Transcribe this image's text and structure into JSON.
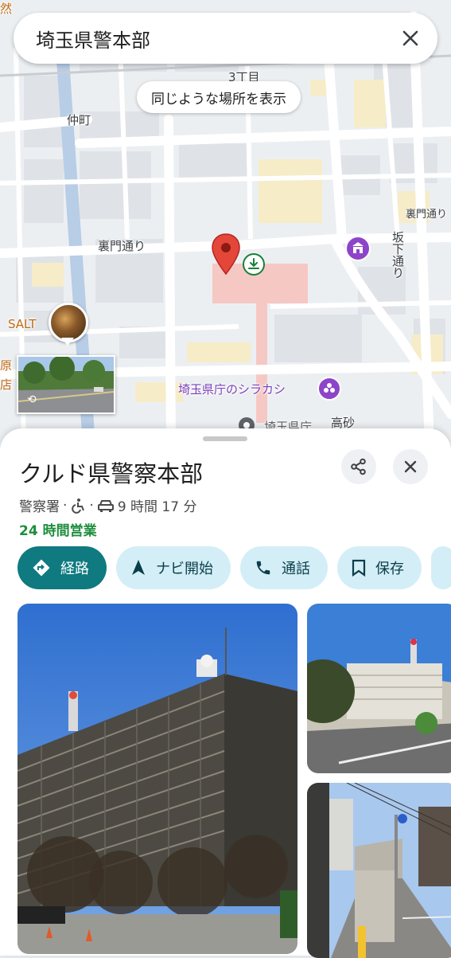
{
  "search": {
    "query": "埼玉県警本部"
  },
  "map": {
    "chip_label": "同じような場所を表示",
    "labels": {
      "nakacho": "仲町",
      "sanchome": "3丁目",
      "uramon_left": "裏門通り",
      "uramon_right": "裏門通り",
      "sakashita": "坂下通り",
      "salt": "SALT",
      "shirakashi": "埼玉県庁のシラカシ",
      "kencho": "埼玉県庁",
      "takasago": "高砂",
      "edge_left_top": "原",
      "edge_left_bottom": "店",
      "corner_top_left": "然"
    },
    "colors": {
      "pin_red": "#e5463a",
      "poi_purple": "#8e44c9",
      "download_green": "#188038"
    }
  },
  "place": {
    "title": "クルド県警察本部",
    "category": "警察署",
    "separator": "·",
    "drive_time": "9 時間 17 分",
    "hours": "24 時間営業"
  },
  "actions": {
    "directions": "経路",
    "navigate": "ナビ開始",
    "call": "通話",
    "save": "保存"
  },
  "icons": {
    "clear": "close-icon",
    "share": "share-icon",
    "close": "close-icon",
    "wheelchair": "wheelchair-icon",
    "car": "car-icon",
    "directions": "directions-icon",
    "navigate": "navigation-arrow-icon",
    "call": "phone-icon",
    "save": "bookmark-icon"
  },
  "accent": {
    "primary": "#0f7a80",
    "tonal": "#d3eef6",
    "open_green": "#1e8e3e"
  }
}
